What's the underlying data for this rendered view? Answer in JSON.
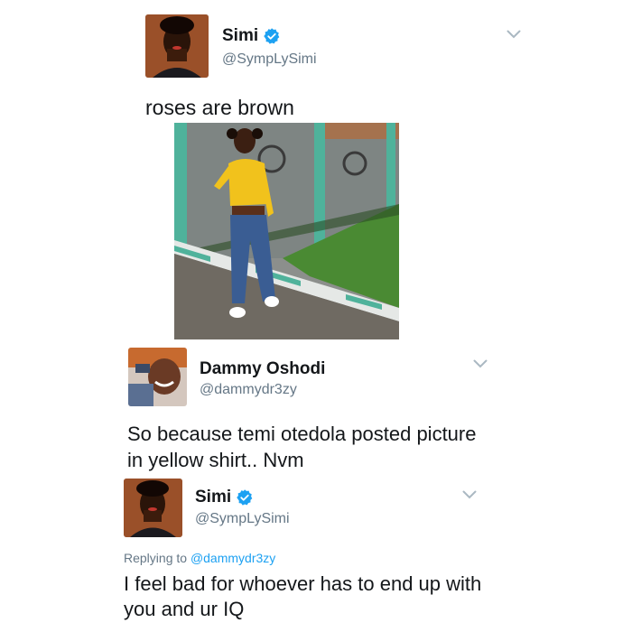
{
  "tweets": [
    {
      "name": "Simi",
      "handle": "@SympLySimi",
      "verified": true,
      "text": "roses are brown",
      "has_photo": true
    },
    {
      "name": "Dammy Oshodi",
      "handle": "@dammydr3zy",
      "verified": false,
      "text_lines": [
        "So because temi otedola posted picture",
        "in yellow shirt.. Nvm"
      ]
    },
    {
      "name": "Simi",
      "handle": "@SympLySimi",
      "verified": true,
      "replying_prefix": "Replying to ",
      "replying_to": "@dammydr3zy",
      "text_lines": [
        "I feel bad for whoever has to end up with",
        "you and ur IQ"
      ]
    }
  ],
  "colors": {
    "verified_blue": "#1da1f2",
    "secondary_text": "#657786",
    "primary_text": "#14171a",
    "chevron": "#aab8c2"
  },
  "icons": {
    "verified": "verified-badge-icon",
    "chevron": "chevron-down-icon"
  }
}
